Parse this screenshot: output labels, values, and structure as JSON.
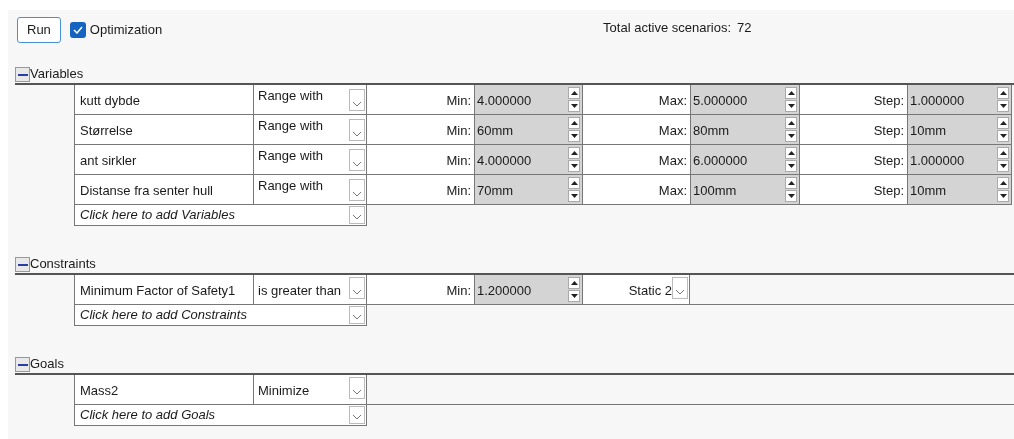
{
  "toolbar": {
    "run_button": "Run",
    "optimization": {
      "label": "Optimization",
      "checked": true
    },
    "total_label": "Total active scenarios:",
    "total_value": "72"
  },
  "variables": {
    "title": "Variables",
    "expanded": true,
    "rows": [
      {
        "name": "kutt dybde",
        "type": "Range with",
        "min_label": "Min:",
        "min": "4.000000",
        "max_label": "Max:",
        "max": "5.000000",
        "step_label": "Step:",
        "step": "1.000000"
      },
      {
        "name": "Størrelse",
        "type": "Range with",
        "min_label": "Min:",
        "min": "60mm",
        "max_label": "Max:",
        "max": "80mm",
        "step_label": "Step:",
        "step": "10mm"
      },
      {
        "name": "ant sirkler",
        "type": "Range with",
        "min_label": "Min:",
        "min": "4.000000",
        "max_label": "Max:",
        "max": "6.000000",
        "step_label": "Step:",
        "step": "1.000000"
      },
      {
        "name": "Distanse fra senter hull",
        "type": "Range with",
        "min_label": "Min:",
        "min": "70mm",
        "max_label": "Max:",
        "max": "100mm",
        "step_label": "Step:",
        "step": "10mm"
      }
    ],
    "add_prompt": "Click here to add Variables"
  },
  "constraints": {
    "title": "Constraints",
    "expanded": true,
    "rows": [
      {
        "name": "Minimum Factor of Safety1",
        "condition": "is greater than",
        "min_label": "Min:",
        "min": "1.200000",
        "study": "Static 2"
      }
    ],
    "add_prompt": "Click here to add Constraints"
  },
  "goals": {
    "title": "Goals",
    "expanded": true,
    "rows": [
      {
        "name": "Mass2",
        "goal": "Minimize"
      }
    ],
    "add_prompt": "Click here to add Goals"
  }
}
